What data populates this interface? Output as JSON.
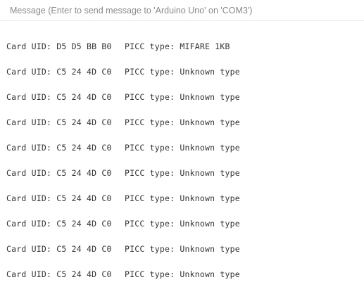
{
  "message_input": {
    "placeholder": "Message (Enter to send message to 'Arduino Uno' on 'COM3')",
    "value": ""
  },
  "serial_output": {
    "lines": [
      {
        "uid": "Card UID: D5 D5 BB B0",
        "picc": "PICC type: MIFARE 1KB"
      },
      {
        "uid": "Card UID: C5 24 4D C0",
        "picc": "PICC type: Unknown type"
      },
      {
        "uid": "Card UID: C5 24 4D C0",
        "picc": "PICC type: Unknown type"
      },
      {
        "uid": "Card UID: C5 24 4D C0",
        "picc": "PICC type: Unknown type"
      },
      {
        "uid": "Card UID: C5 24 4D C0",
        "picc": "PICC type: Unknown type"
      },
      {
        "uid": "Card UID: C5 24 4D C0",
        "picc": "PICC type: Unknown type"
      },
      {
        "uid": "Card UID: C5 24 4D C0",
        "picc": "PICC type: Unknown type"
      },
      {
        "uid": "Card UID: C5 24 4D C0",
        "picc": "PICC type: Unknown type"
      },
      {
        "uid": "Card UID: C5 24 4D C0",
        "picc": "PICC type: Unknown type"
      },
      {
        "uid": "Card UID: C5 24 4D C0",
        "picc": "PICC type: Unknown type"
      }
    ]
  }
}
